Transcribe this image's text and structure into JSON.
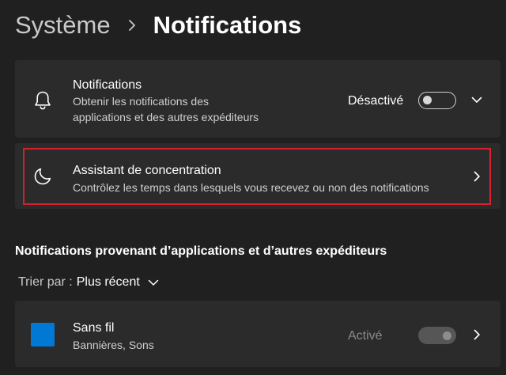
{
  "header": {
    "parent": "Système",
    "separator_icon": "chevron-right",
    "current": "Notifications"
  },
  "notifications_card": {
    "icon": "bell",
    "title": "Notifications",
    "description_line1": "Obtenir les notifications des",
    "description_line2": "applications et des autres expéditeurs",
    "state_label": "Désactivé",
    "toggle_on": false,
    "expand_icon": "chevron-down"
  },
  "focus_card": {
    "icon": "moon",
    "title": "Assistant de concentration",
    "description": "Contrôlez les temps dans lesquels vous recevez ou non des notifications",
    "nav_icon": "chevron-right",
    "highlight_color": "#d4202c"
  },
  "apps_section": {
    "title": "Notifications provenant d’applications et d’autres expéditeurs",
    "sort_label": "Trier par :",
    "sort_value": "Plus récent",
    "sort_icon": "chevron-down"
  },
  "app_items": [
    {
      "icon": "blue-square",
      "icon_color": "#0078d4",
      "name": "Sans fil",
      "detail": "Bannières, Sons",
      "state_label": "Activé",
      "toggle_on": true,
      "disabled": true,
      "nav_icon": "chevron-right"
    }
  ],
  "colors": {
    "background": "#202020",
    "card": "#2b2b2b",
    "accent": "#0078d4"
  }
}
